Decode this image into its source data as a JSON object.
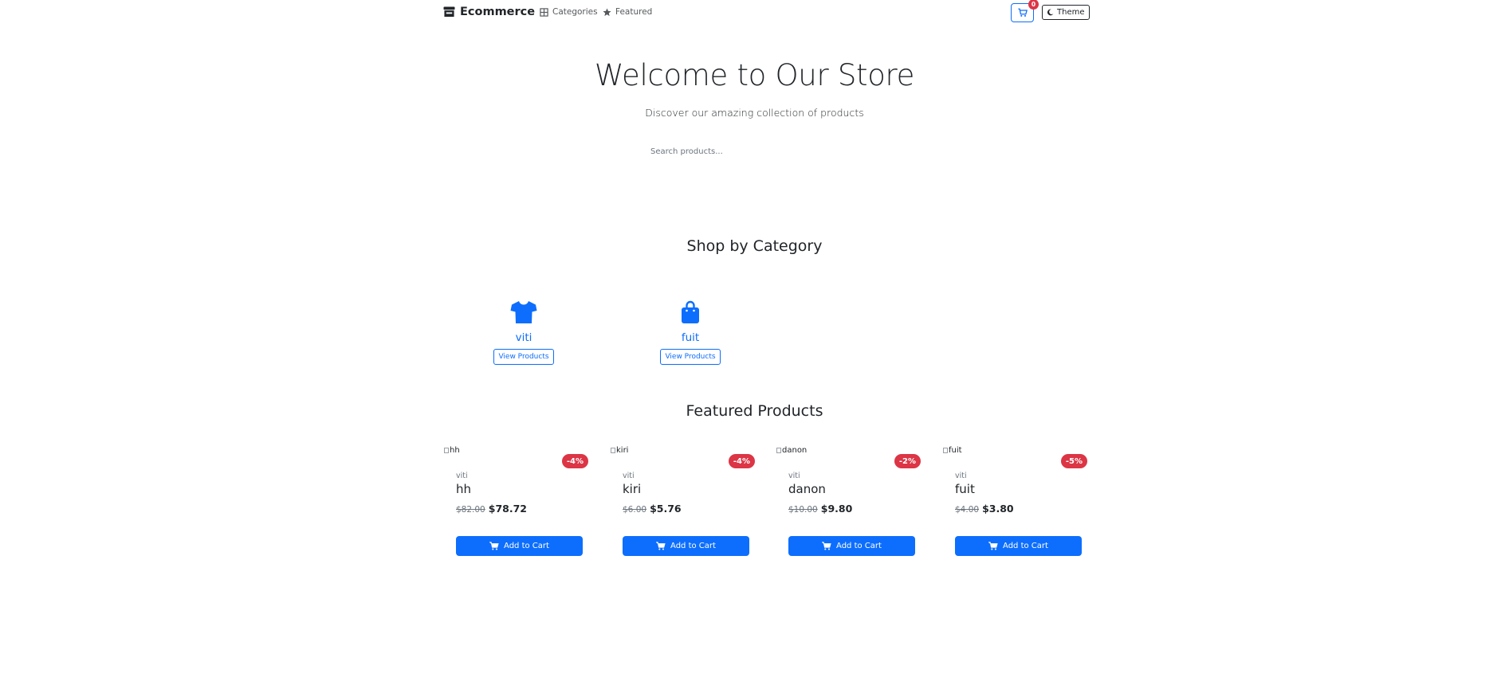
{
  "navbar": {
    "brand": "Ecommerce",
    "brand_icon": "store-icon",
    "links": [
      {
        "label": "Categories",
        "icon": "grid-icon"
      },
      {
        "label": "Featured",
        "icon": "star-icon"
      }
    ],
    "cart_count": "0",
    "theme_label": "Theme"
  },
  "hero": {
    "title": "Welcome to Our Store",
    "subtitle": "Discover our amazing collection of products",
    "search_placeholder": "Search products..."
  },
  "categories_section": {
    "title": "Shop by Category",
    "items": [
      {
        "name": "viti",
        "icon": "tshirt-icon",
        "button": "View Products"
      },
      {
        "name": "fuit",
        "icon": "shopping-bag-icon",
        "button": "View Products"
      }
    ]
  },
  "featured_section": {
    "title": "Featured Products",
    "products": [
      {
        "image_alt": "hh",
        "discount": "-4%",
        "category": "viti",
        "name": "hh",
        "old_price": "$82.00",
        "price": "$78.72",
        "button": "Add to Cart"
      },
      {
        "image_alt": "kiri",
        "discount": "-4%",
        "category": "viti",
        "name": "kiri",
        "old_price": "$6.00",
        "price": "$5.76",
        "button": "Add to Cart"
      },
      {
        "image_alt": "danon",
        "discount": "-2%",
        "category": "viti",
        "name": "danon",
        "old_price": "$10.00",
        "price": "$9.80",
        "button": "Add to Cart"
      },
      {
        "image_alt": "fuit",
        "discount": "-5%",
        "category": "viti",
        "name": "fuit",
        "old_price": "$4.00",
        "price": "$3.80",
        "button": "Add to Cart"
      }
    ]
  },
  "colors": {
    "primary": "#0d6efd",
    "danger": "#dc3545",
    "text": "#212529",
    "muted": "#6c757d"
  }
}
